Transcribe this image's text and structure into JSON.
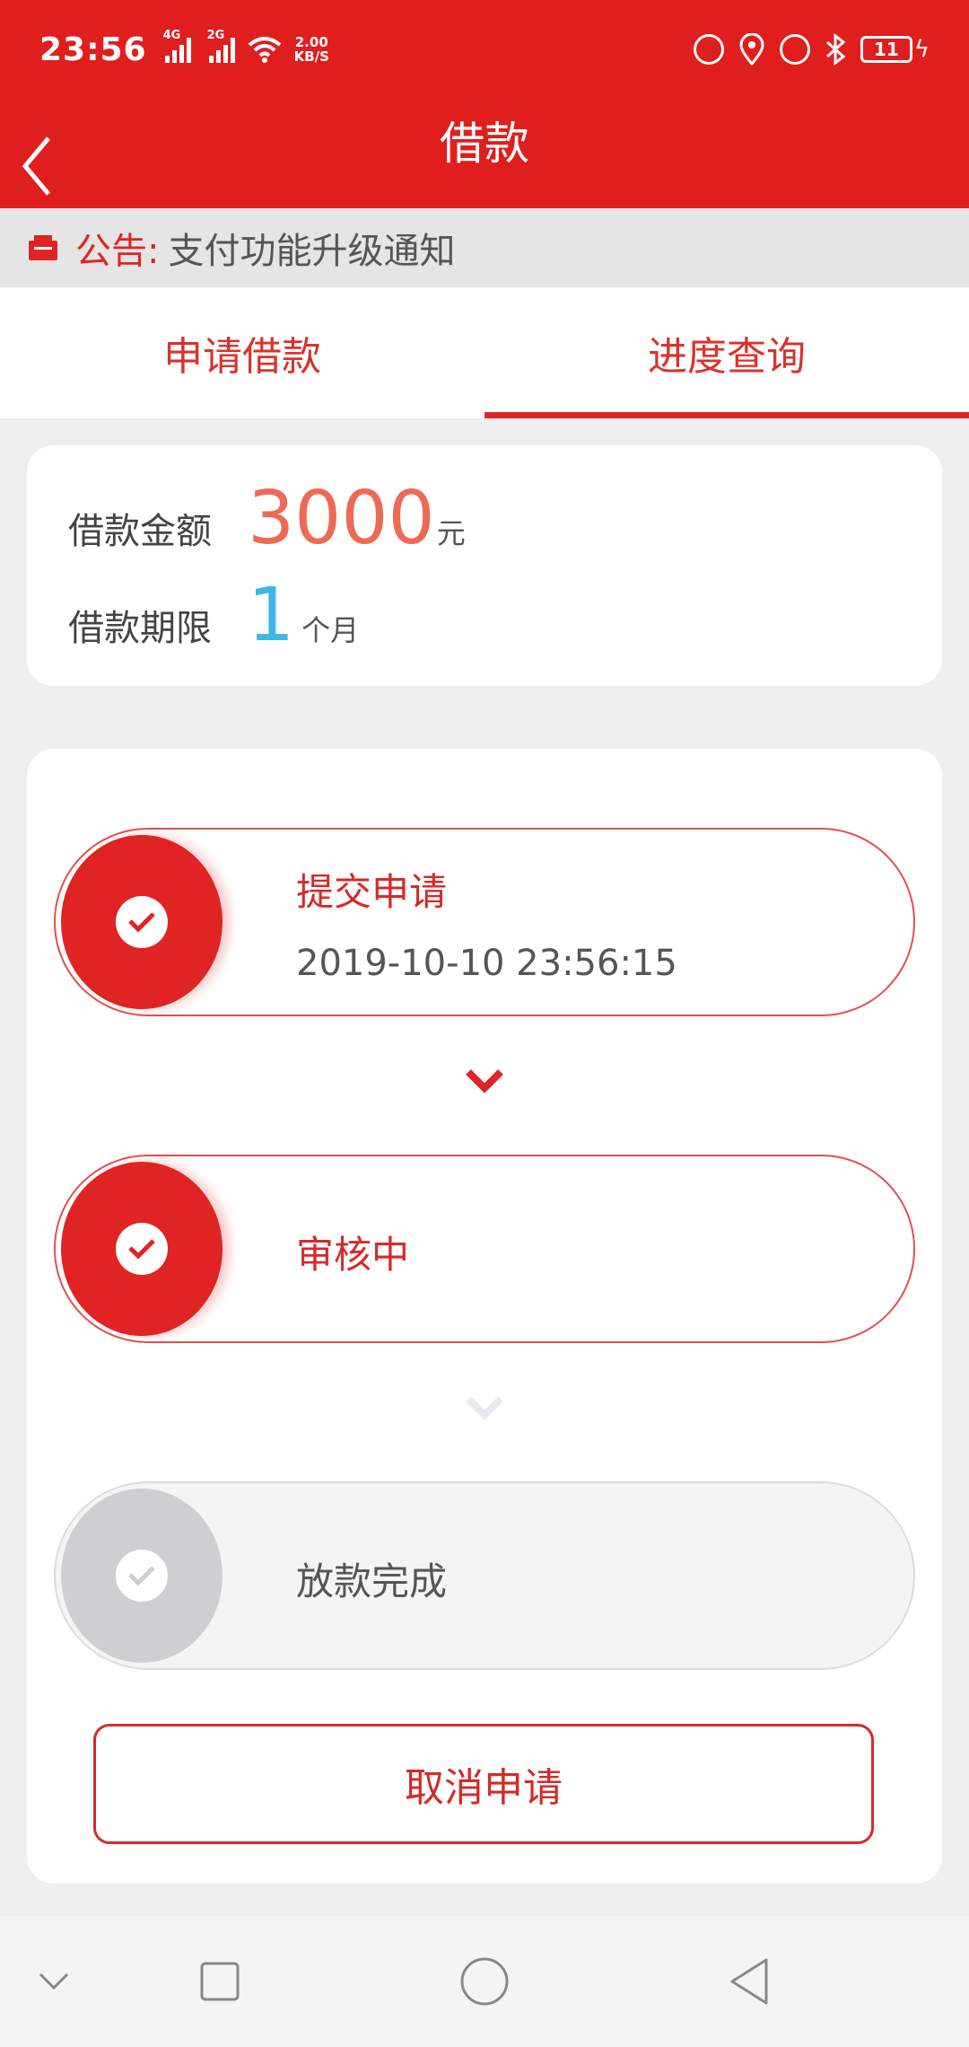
{
  "status_bar": {
    "time": "23:56",
    "signal1_tag": "4G",
    "signal2_tag": "2G",
    "speed_value": "2.00",
    "speed_unit": "KB/S",
    "battery": "11"
  },
  "nav": {
    "title": "借款"
  },
  "notice": {
    "label": "公告:",
    "text": "支付功能升级通知"
  },
  "tabs": [
    {
      "label": "申请借款",
      "active": false
    },
    {
      "label": "进度查询",
      "active": true
    }
  ],
  "summary": {
    "amount_label": "借款金额",
    "amount_value": "3000",
    "amount_unit": "元",
    "term_label": "借款期限",
    "term_value": "1",
    "term_unit": "个月"
  },
  "steps": [
    {
      "title": "提交申请",
      "time": "2019-10-10 23:56:15",
      "status": "done"
    },
    {
      "title": "审核中",
      "status": "done"
    },
    {
      "title": "放款完成",
      "status": "pending"
    }
  ],
  "cancel_label": "取消申请",
  "colors": {
    "brand_red": "#e01e1e",
    "amount": "#ee6a55",
    "term": "#3fb7e4",
    "pending": "#cfcfd2"
  }
}
